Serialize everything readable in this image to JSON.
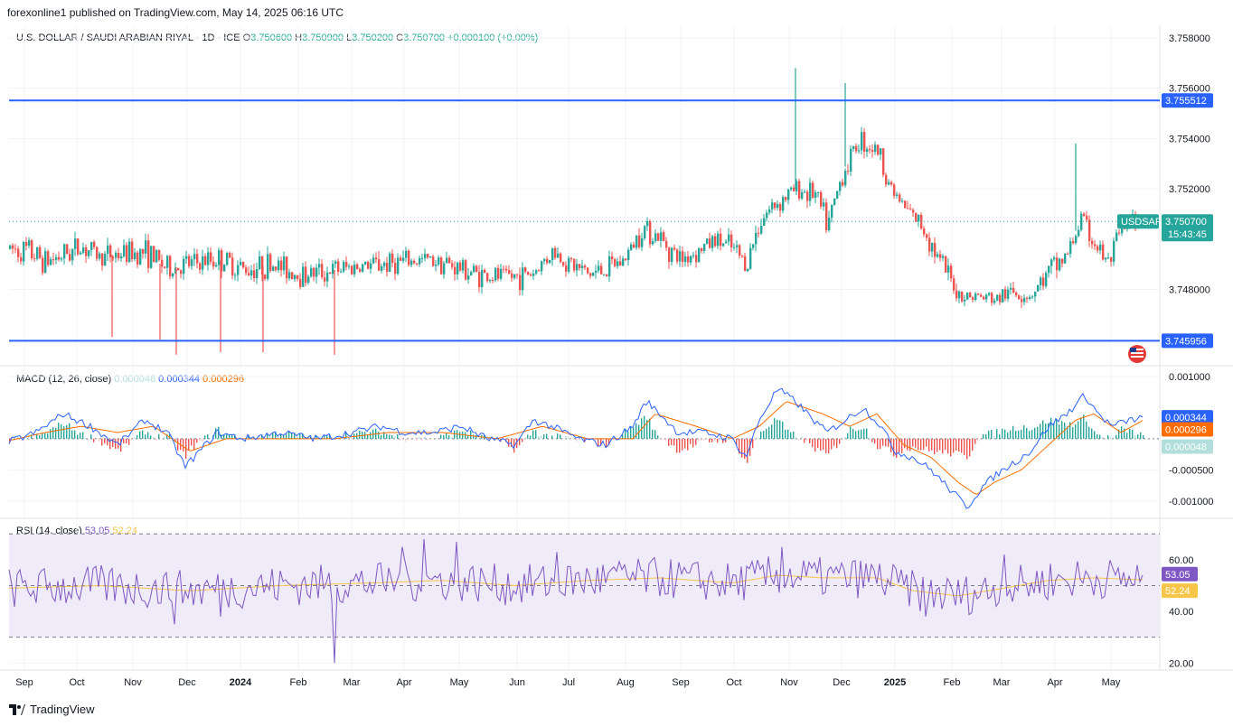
{
  "header": {
    "published": "forexonline1 published on TradingView.com, May 14, 2025 06:16 UTC"
  },
  "main_pane": {
    "symbol": "U.S. DOLLAR / SAUDI ARABIAN RIYAL · 1D · ICE",
    "o_label": "O",
    "o": "3.750600",
    "h_label": "H",
    "h": "3.750900",
    "l_label": "L",
    "l": "3.750200",
    "c_label": "C",
    "c": "3.750700",
    "change": "+0.000100 (+0.00%)"
  },
  "macd_pane": {
    "title": "MACD (12, 26, close)",
    "hist": "0.000048",
    "macd": "0.000344",
    "signal": "0.000296"
  },
  "rsi_pane": {
    "title": "RSI (14, close)",
    "rsi": "53.05",
    "ma": "52.24"
  },
  "tags": {
    "symbol": "USDSAR",
    "last_price": "3.750700",
    "countdown": "15:43:45",
    "resistance": "3.755512",
    "support": "3.745956",
    "macd_val": "0.000344",
    "signal_val": "0.000296",
    "hist_val": "0.000048",
    "rsi_val": "53.05",
    "rsi_ma_val": "52.24"
  },
  "colors": {
    "up": "#26a69a",
    "down": "#ef5350",
    "level": "#2962ff",
    "macd": "#2962ff",
    "signal": "#ff6d00",
    "rsi": "#7e57c2",
    "rsi_ma": "#f7c548",
    "band": "#f0ebf9"
  },
  "chart_data": [
    {
      "type": "candlestick",
      "title": "U.S. DOLLAR / SAUDI ARABIAN RIYAL · 1D · ICE",
      "y_ticks": [
        "3.758000",
        "3.756000",
        "3.754000",
        "3.752000",
        "3.748000"
      ],
      "y_tick_values": [
        3.758,
        3.756,
        3.754,
        3.752,
        3.748
      ],
      "ylim": [
        3.745,
        3.7585
      ],
      "x_ticks": [
        "Sep",
        "Oct",
        "Nov",
        "Dec",
        "2024",
        "Feb",
        "Mar",
        "Apr",
        "May",
        "Jun",
        "Jul",
        "Aug",
        "Sep",
        "Oct",
        "Nov",
        "Dec",
        "2025",
        "Feb",
        "Mar",
        "Apr",
        "May"
      ],
      "horizontal_levels": [
        3.755512,
        3.745956
      ],
      "last_close": 3.7507,
      "path": [
        [
          0,
          3.7496
        ],
        [
          20,
          3.7495
        ],
        [
          40,
          3.7491
        ],
        [
          60,
          3.7494
        ],
        [
          80,
          3.7497
        ],
        [
          100,
          3.7493
        ],
        [
          120,
          3.7494
        ],
        [
          150,
          3.7495
        ],
        [
          175,
          3.7488
        ],
        [
          200,
          3.749
        ],
        [
          230,
          3.7492
        ],
        [
          260,
          3.7488
        ],
        [
          290,
          3.749
        ],
        [
          320,
          3.7486
        ],
        [
          350,
          3.7487
        ],
        [
          380,
          3.7489
        ],
        [
          410,
          3.749
        ],
        [
          440,
          3.7491
        ],
        [
          470,
          3.7492
        ],
        [
          500,
          3.7488
        ],
        [
          530,
          3.7485
        ],
        [
          560,
          3.7485
        ],
        [
          580,
          3.7487
        ],
        [
          600,
          3.7495
        ],
        [
          620,
          3.749
        ],
        [
          640,
          3.7486
        ],
        [
          660,
          3.7488
        ],
        [
          680,
          3.7492
        ],
        [
          700,
          3.7505
        ],
        [
          720,
          3.75
        ],
        [
          740,
          3.7492
        ],
        [
          760,
          3.7495
        ],
        [
          780,
          3.75
        ],
        [
          800,
          3.7496
        ],
        [
          815,
          3.749
        ],
        [
          830,
          3.7508
        ],
        [
          850,
          3.7515
        ],
        [
          870,
          3.752
        ],
        [
          890,
          3.7518
        ],
        [
          905,
          3.7505
        ],
        [
          920,
          3.7525
        ],
        [
          940,
          3.754
        ],
        [
          960,
          3.7535
        ],
        [
          975,
          3.752
        ],
        [
          990,
          3.7512
        ],
        [
          1010,
          3.7505
        ],
        [
          1030,
          3.749
        ],
        [
          1050,
          3.7478
        ],
        [
          1070,
          3.7477
        ],
        [
          1090,
          3.7476
        ],
        [
          1110,
          3.7479
        ],
        [
          1130,
          3.7478
        ],
        [
          1150,
          3.7487
        ],
        [
          1170,
          3.7494
        ],
        [
          1185,
          3.7508
        ],
        [
          1200,
          3.7498
        ],
        [
          1215,
          3.749
        ],
        [
          1230,
          3.7503
        ],
        [
          1250,
          3.7507
        ]
      ],
      "volatility": 0.0004
    },
    {
      "type": "line",
      "title": "MACD (12, 26, close)",
      "y_ticks": [
        "0.001000",
        "-0.000500",
        "-0.001000"
      ],
      "y_tick_values": [
        0.001,
        -0.0005,
        -0.001
      ],
      "ylim": [
        -0.00125,
        0.00113
      ],
      "series": [
        {
          "name": "MACD",
          "path": [
            [
              0,
              -5e-05
            ],
            [
              30,
              0.0001
            ],
            [
              60,
              0.0004
            ],
            [
              90,
              0.0002
            ],
            [
              120,
              -0.0001
            ],
            [
              150,
              0.0003
            ],
            [
              175,
              0.0001
            ],
            [
              195,
              -0.00045
            ],
            [
              230,
              0.0001
            ],
            [
              260,
              0.0
            ],
            [
              300,
              0.0001
            ],
            [
              340,
              0.0
            ],
            [
              380,
              0.0001
            ],
            [
              410,
              0.0002
            ],
            [
              440,
              0.0001
            ],
            [
              470,
              0.0001
            ],
            [
              500,
              0.0002
            ],
            [
              530,
              0.0
            ],
            [
              560,
              -0.0001
            ],
            [
              580,
              0.0003
            ],
            [
              600,
              0.0002
            ],
            [
              630,
              0.0
            ],
            [
              660,
              -0.0001
            ],
            [
              690,
              0.0002
            ],
            [
              705,
              0.0006
            ],
            [
              720,
              0.0004
            ],
            [
              740,
              0.0001
            ],
            [
              770,
              0.0001
            ],
            [
              800,
              0.0
            ],
            [
              815,
              -0.0003
            ],
            [
              830,
              0.0003
            ],
            [
              850,
              0.0008
            ],
            [
              870,
              0.0006
            ],
            [
              890,
              0.0003
            ],
            [
              905,
              0.0001
            ],
            [
              925,
              0.0003
            ],
            [
              945,
              0.0005
            ],
            [
              965,
              0.0002
            ],
            [
              980,
              -0.0002
            ],
            [
              1000,
              -0.0003
            ],
            [
              1020,
              -0.0005
            ],
            [
              1040,
              -0.0008
            ],
            [
              1060,
              -0.0011
            ],
            [
              1075,
              -0.0008
            ],
            [
              1090,
              -0.0006
            ],
            [
              1110,
              -0.0004
            ],
            [
              1130,
              -0.0002
            ],
            [
              1150,
              0.0002
            ],
            [
              1170,
              0.0004
            ],
            [
              1190,
              0.0007
            ],
            [
              1205,
              0.0004
            ],
            [
              1220,
              0.0002
            ],
            [
              1240,
              0.0003
            ],
            [
              1255,
              0.00034
            ]
          ]
        },
        {
          "name": "Signal",
          "path": [
            [
              0,
              -3e-05
            ],
            [
              40,
              0.0001
            ],
            [
              80,
              0.0002
            ],
            [
              120,
              0.0001
            ],
            [
              160,
              0.0002
            ],
            [
              200,
              -0.0002
            ],
            [
              240,
              0.0
            ],
            [
              300,
              0.0
            ],
            [
              360,
              0.0
            ],
            [
              420,
              0.0001
            ],
            [
              480,
              0.0001
            ],
            [
              540,
              0.0
            ],
            [
              590,
              0.0002
            ],
            [
              640,
              0.0
            ],
            [
              690,
              0.0
            ],
            [
              715,
              0.0004
            ],
            [
              760,
              0.0002
            ],
            [
              800,
              0.0
            ],
            [
              830,
              0.0002
            ],
            [
              860,
              0.0006
            ],
            [
              900,
              0.0004
            ],
            [
              930,
              0.0002
            ],
            [
              960,
              0.0004
            ],
            [
              990,
              -0.0001
            ],
            [
              1020,
              -0.0003
            ],
            [
              1050,
              -0.0007
            ],
            [
              1070,
              -0.0009
            ],
            [
              1090,
              -0.0007
            ],
            [
              1120,
              -0.0005
            ],
            [
              1150,
              -0.0001
            ],
            [
              1180,
              0.0003
            ],
            [
              1200,
              0.0004
            ],
            [
              1230,
              0.0001
            ],
            [
              1255,
              0.0003
            ]
          ]
        }
      ]
    },
    {
      "type": "line",
      "title": "RSI (14, close)",
      "y_ticks": [
        "60.00",
        "40.00",
        "20.00"
      ],
      "y_tick_values": [
        60,
        40,
        20
      ],
      "ylim": [
        18,
        75
      ],
      "bands": [
        30,
        70
      ],
      "series": [
        {
          "name": "RSI",
          "mean": 50,
          "spikes": [
            [
              193,
              35
            ],
            [
              245,
              38
            ],
            [
              370,
              20
            ],
            [
              445,
              65
            ],
            [
              470,
              68
            ],
            [
              505,
              67
            ],
            [
              615,
              63
            ],
            [
              690,
              58
            ],
            [
              865,
              65
            ],
            [
              1025,
              38
            ],
            [
              1110,
              62
            ]
          ]
        },
        {
          "name": "MA",
          "path": [
            [
              0,
              49
            ],
            [
              100,
              50
            ],
            [
              200,
              48
            ],
            [
              300,
              50
            ],
            [
              400,
              51
            ],
            [
              480,
              52
            ],
            [
              560,
              50
            ],
            [
              640,
              52
            ],
            [
              720,
              53
            ],
            [
              800,
              51
            ],
            [
              850,
              54
            ],
            [
              900,
              53
            ],
            [
              960,
              53
            ],
            [
              1000,
              48
            ],
            [
              1050,
              46
            ],
            [
              1100,
              49
            ],
            [
              1150,
              52
            ],
            [
              1200,
              53
            ],
            [
              1255,
              52.24
            ]
          ]
        }
      ]
    }
  ]
}
